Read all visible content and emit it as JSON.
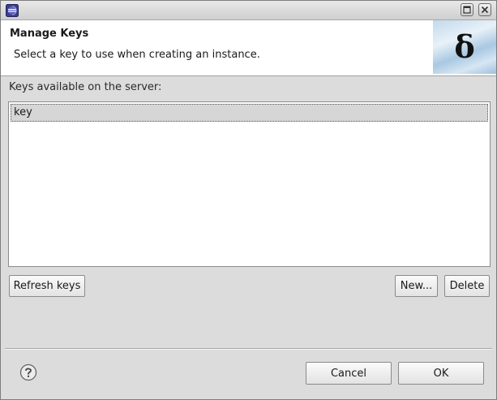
{
  "window": {
    "app_icon": "eclipse-icon",
    "controls": [
      {
        "name": "maximize-button",
        "icon": "maximize-icon"
      },
      {
        "name": "close-button",
        "icon": "close-icon"
      }
    ]
  },
  "header": {
    "title": "Manage Keys",
    "description": "Select a key to use when creating an instance.",
    "banner_glyph": "δ",
    "banner_icon": "deltacloud-logo"
  },
  "keys": {
    "label": "Keys available on the server:",
    "items": [
      {
        "name": "key",
        "selected": true
      }
    ]
  },
  "actions": {
    "refresh_label": "Refresh keys",
    "new_label": "New...",
    "delete_label": "Delete"
  },
  "footer": {
    "help_icon": "help-icon",
    "cancel_label": "Cancel",
    "ok_label": "OK"
  },
  "colors": {
    "dialog_bg": "#dcdcdc",
    "selection_bg": "#d6d6d6",
    "header_bg": "#ffffff"
  }
}
